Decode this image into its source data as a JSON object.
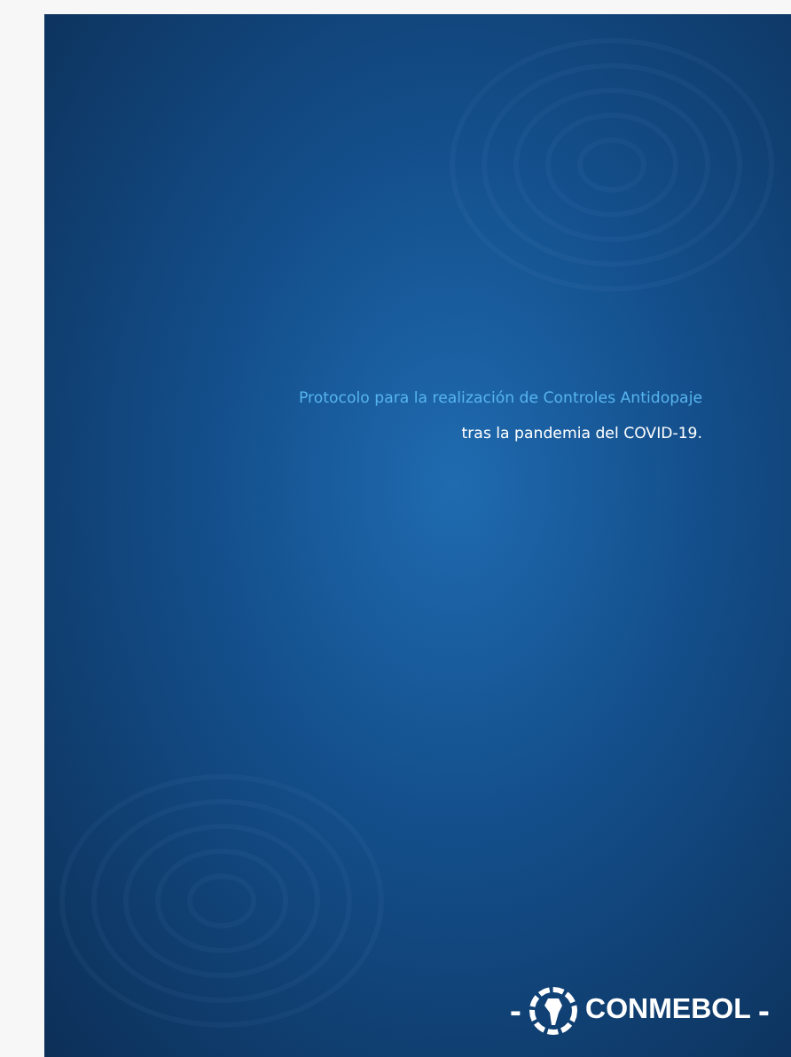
{
  "page": {
    "title": "Protocolo para la realización de Controles Antidopaje",
    "subtitle": "tras la pandemia del COVID-19.",
    "logo": {
      "dash_left": "-",
      "text": "CONMEBOL",
      "dash_right": "-"
    }
  }
}
